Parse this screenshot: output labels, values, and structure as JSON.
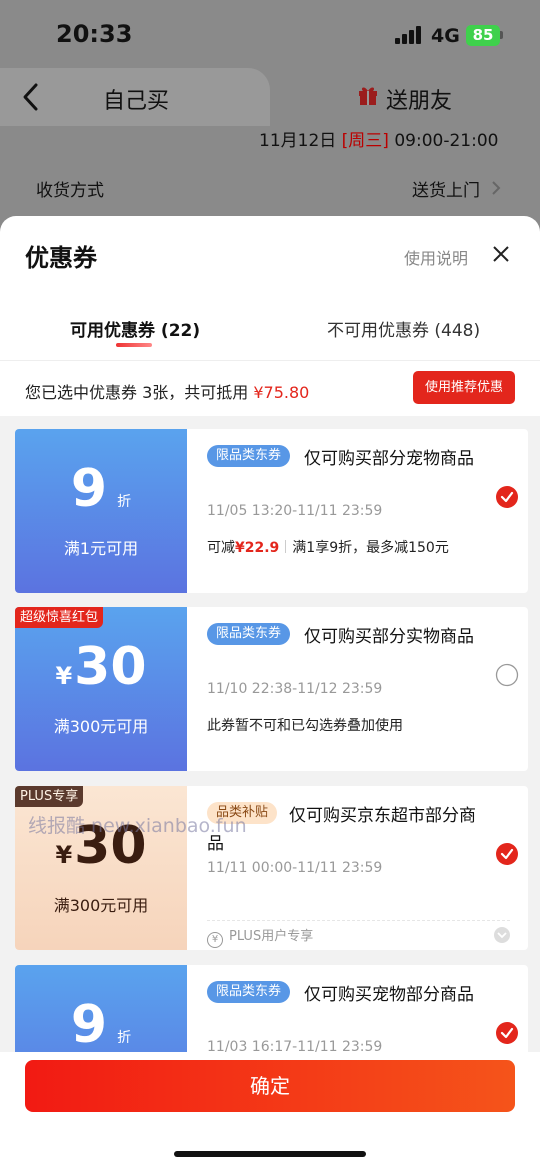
{
  "status_bar": {
    "time": "20:33",
    "network": "4G",
    "battery": "85"
  },
  "background": {
    "tabs": {
      "self": "自己买",
      "gift": "送朋友"
    },
    "date_prefix": "11月12日 ",
    "weekday": "[周三]",
    "time_range": " 09:00-21:00",
    "delivery_label": "收货方式",
    "delivery_value": "送货上门"
  },
  "sheet": {
    "title": "优惠券",
    "help": "使用说明",
    "tabs": {
      "available": "可用优惠券 (22)",
      "unavailable": "不可用优惠券 (448)"
    },
    "summary": {
      "text": "您已选中优惠券 3张，共可抵用 ",
      "amount": "¥75.80"
    },
    "recommend_button": "使用推荐优惠",
    "confirm_button": "确定"
  },
  "coupons": [
    {
      "value": "9",
      "unit": "折",
      "threshold": "满1元可用",
      "tag": "限品类东券",
      "description": "仅可购买部分宠物商品",
      "validity": "11/05 13:20-11/11 23:59",
      "detail_prefix": "可减",
      "detail_amount": "¥22.9",
      "detail_rule": "满1享9折，最多减150元",
      "selected": true
    },
    {
      "corner": "超级惊喜红包",
      "currency": "¥",
      "value": "30",
      "threshold": "满300元可用",
      "tag": "限品类东券",
      "description": "仅可购买部分实物商品",
      "validity": "11/10 22:38-11/12 23:59",
      "detail": "此券暂不可和已勾选券叠加使用",
      "selected": false
    },
    {
      "corner": "PLUS专享",
      "currency": "¥",
      "value": "30",
      "threshold": "满300元可用",
      "tag": "品类补贴",
      "description_line1": "仅可购买京东超市部分商",
      "description_line2": "品",
      "validity": "11/11 00:00-11/11 23:59",
      "plus_note": "PLUS用户专享",
      "selected": true
    },
    {
      "value": "9",
      "unit": "折",
      "tag": "限品类东券",
      "description": "仅可购买宠物部分商品",
      "validity": "11/03 16:17-11/11 23:59",
      "selected": true
    }
  ],
  "watermark": "线报酷 new.xianbao.fun",
  "colors": {
    "accent_red": "#e3261c",
    "coupon_blue": "#5b85e6",
    "plus_peach": "#f8dcc6"
  }
}
